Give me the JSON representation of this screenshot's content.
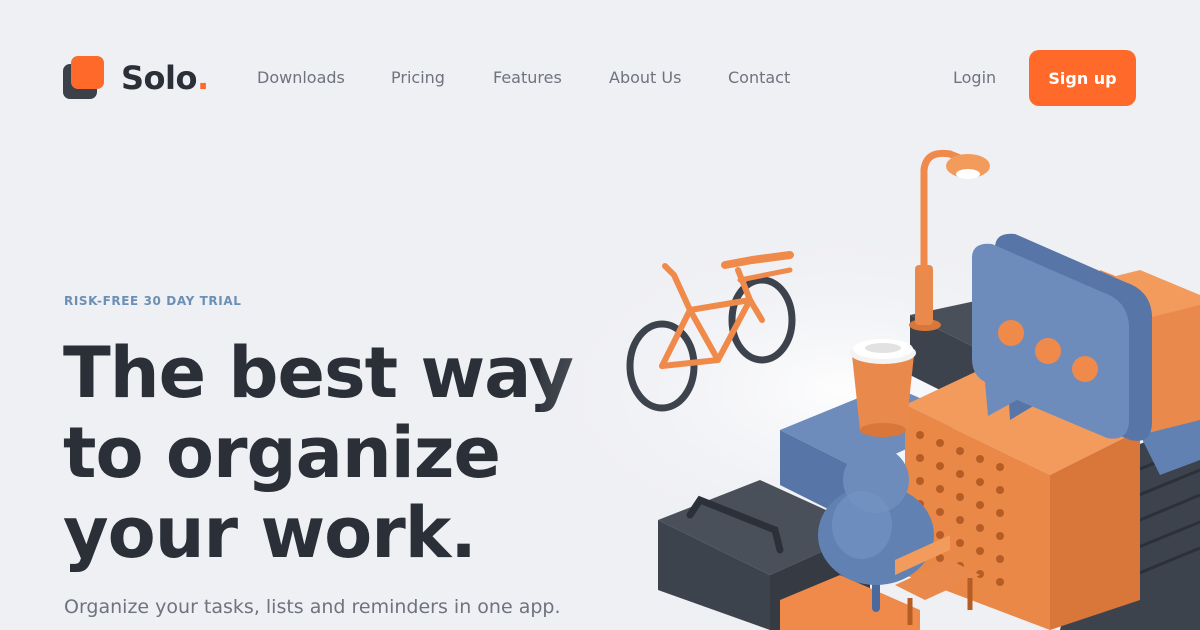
{
  "brand": {
    "name": "Solo",
    "dot": ".",
    "accent": "#ff6a2b",
    "dark": "#2a2f38"
  },
  "nav": {
    "items": [
      {
        "label": "Downloads"
      },
      {
        "label": "Pricing"
      },
      {
        "label": "Features"
      },
      {
        "label": "About Us"
      },
      {
        "label": "Contact"
      }
    ],
    "login_label": "Login",
    "signup_label": "Sign up"
  },
  "hero": {
    "eyebrow": "RISK-FREE 30 DAY TRIAL",
    "title_lines": [
      "The best way",
      "to organize",
      "your work."
    ],
    "subtitle": "Organize your tasks, lists and reminders in one app."
  },
  "illustration": {
    "icons": [
      "bicycle-icon",
      "street-lamp-icon",
      "coffee-cup-icon",
      "chat-bubble-icon",
      "tree-icon",
      "bench-icon",
      "stairs-icon"
    ],
    "colors": {
      "orange": "#f08a4b",
      "blue": "#6281b3",
      "slate": "#3d434d"
    }
  }
}
